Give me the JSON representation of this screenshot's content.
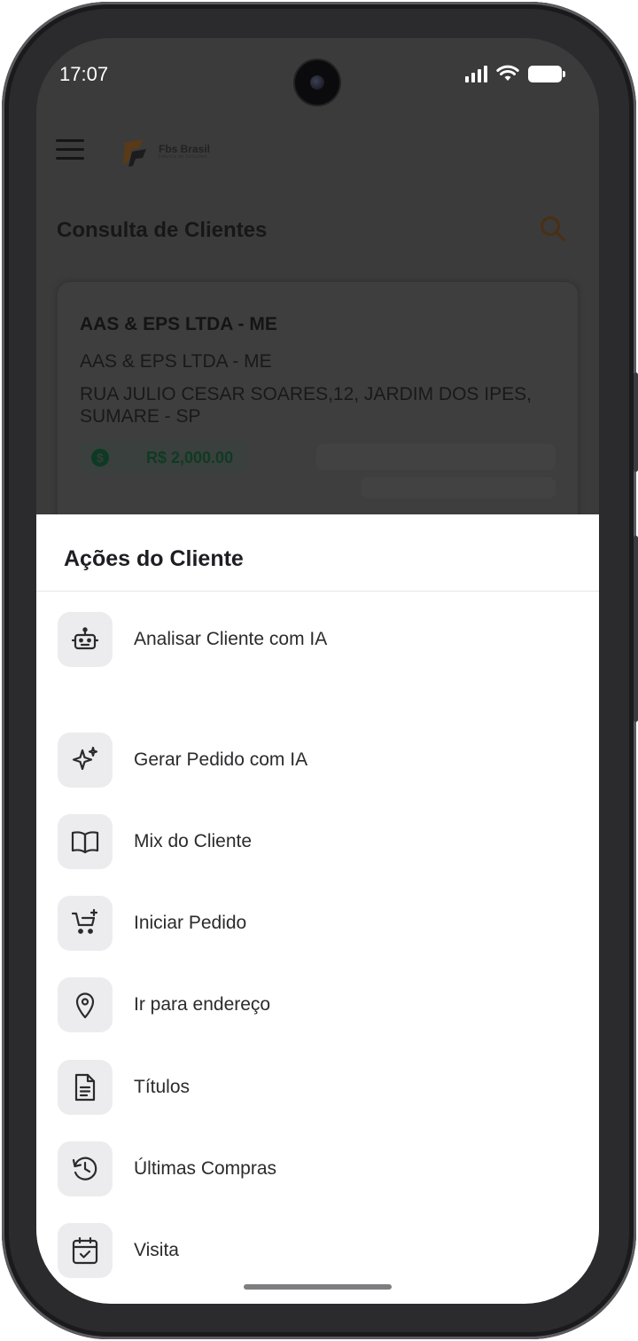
{
  "status_bar": {
    "time": "17:07"
  },
  "header": {
    "logo_text": "Fbs Brasil",
    "logo_subtitle": "Fábrica de Soluções",
    "page_title": "Consulta de Clientes"
  },
  "client_card": {
    "razao_social": "AAS & EPS LTDA - ME",
    "nome_fantasia": "AAS & EPS LTDA - ME",
    "address": "RUA JULIO CESAR SOARES,12, JARDIM DOS IPES, SUMARE - SP",
    "limit_icon": "dollar-icon",
    "limit_value": "R$ 2,000.00"
  },
  "sheet": {
    "title": "Ações do Cliente",
    "actions": [
      {
        "label": "Analisar Cliente com IA",
        "icon": "robot-icon"
      },
      {
        "label": "Gerar Pedido com IA",
        "icon": "sparkles-icon"
      },
      {
        "label": "Mix do Cliente",
        "icon": "book-open-icon"
      },
      {
        "label": "Iniciar Pedido",
        "icon": "cart-plus-icon"
      },
      {
        "label": "Ir para endereço",
        "icon": "map-pin-icon"
      },
      {
        "label": "Títulos",
        "icon": "document-icon"
      },
      {
        "label": "Últimas Compras",
        "icon": "history-icon"
      },
      {
        "label": "Visita",
        "icon": "calendar-check-icon"
      }
    ]
  },
  "colors": {
    "overlay": "#3b3b3c",
    "sheet_background": "#ffffff",
    "icon_tile": "#ececee",
    "brand_orange": "#e07a1f"
  }
}
